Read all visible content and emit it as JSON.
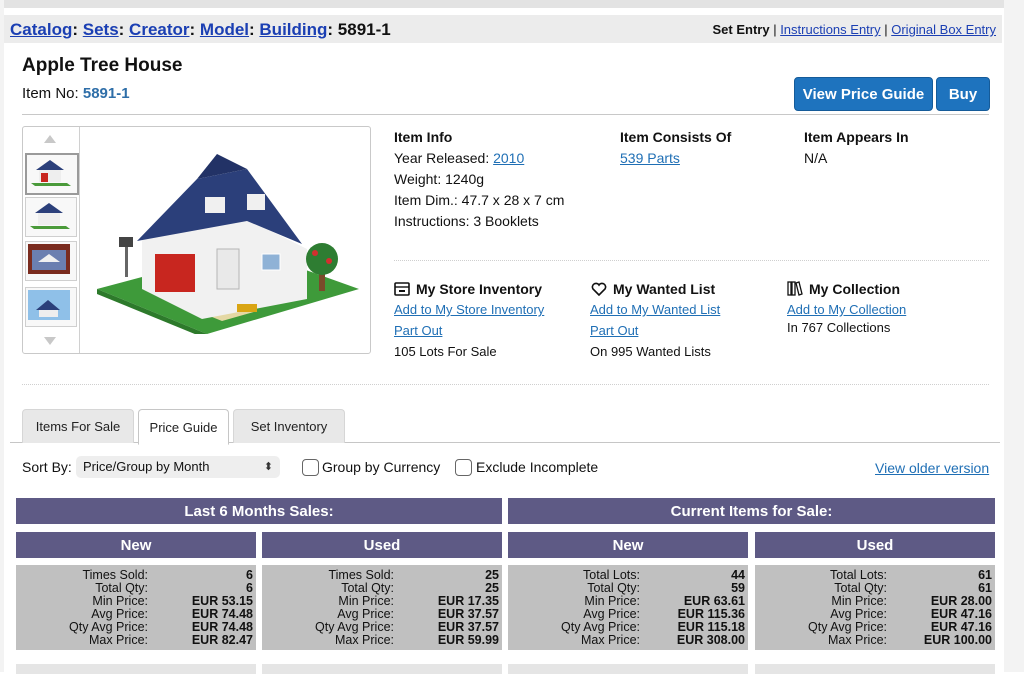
{
  "breadcrumb": [
    {
      "label": "Catalog"
    },
    {
      "label": "Sets"
    },
    {
      "label": "Creator"
    },
    {
      "label": "Model"
    },
    {
      "label": "Building"
    }
  ],
  "breadcrumb_current": "5891-1",
  "entry_links": {
    "set_entry": "Set Entry",
    "instructions_entry": "Instructions Entry",
    "box_entry": "Original Box Entry"
  },
  "item": {
    "title": "Apple Tree House",
    "item_no_label": "Item No:",
    "item_no": "5891-1"
  },
  "buttons": {
    "price_guide": "View Price Guide",
    "buy": "Buy"
  },
  "info": {
    "item_info_heading": "Item Info",
    "year_label": "Year Released:",
    "year": "2010",
    "weight": "Weight: 1240g",
    "dim": "Item Dim.: 47.7 x 28 x 7 cm",
    "instructions": "Instructions: 3 Booklets",
    "consists_heading": "Item Consists Of",
    "parts": "539 Parts",
    "appears_heading": "Item Appears In",
    "appears": "N/A"
  },
  "store": {
    "heading": "My Store Inventory",
    "add": "Add to My Store Inventory",
    "part_out": "Part Out",
    "count": "105 Lots For Sale"
  },
  "wanted": {
    "heading": "My Wanted List",
    "add": "Add to My Wanted List",
    "part_out": "Part Out",
    "count": "On 995 Wanted Lists"
  },
  "collection": {
    "heading": "My Collection",
    "add": "Add to My Collection",
    "count": "In 767 Collections"
  },
  "tabs": [
    {
      "label": "Items For Sale",
      "active": false
    },
    {
      "label": "Price Guide",
      "active": true
    },
    {
      "label": "Set Inventory",
      "active": false
    }
  ],
  "sort": {
    "label": "Sort By:",
    "value": "Price/Group by Month"
  },
  "checkboxes": {
    "group_currency": "Group by Currency",
    "exclude_incomplete": "Exclude Incomplete"
  },
  "older_version": "View older version",
  "price_guide": {
    "sales_heading": "Last 6 Months Sales:",
    "current_heading": "Current Items for Sale:",
    "new_label": "New",
    "used_label": "Used",
    "sales_new": [
      [
        "Times Sold:",
        "6"
      ],
      [
        "Total Qty:",
        "6"
      ],
      [
        "Min Price:",
        "EUR 53.15"
      ],
      [
        "Avg Price:",
        "EUR 74.48"
      ],
      [
        "Qty Avg Price:",
        "EUR 74.48"
      ],
      [
        "Max Price:",
        "EUR 82.47"
      ]
    ],
    "sales_used": [
      [
        "Times Sold:",
        "25"
      ],
      [
        "Total Qty:",
        "25"
      ],
      [
        "Min Price:",
        "EUR 17.35"
      ],
      [
        "Avg Price:",
        "EUR 37.57"
      ],
      [
        "Qty Avg Price:",
        "EUR 37.57"
      ],
      [
        "Max Price:",
        "EUR 59.99"
      ]
    ],
    "current_new": [
      [
        "Total Lots:",
        "44"
      ],
      [
        "Total Qty:",
        "59"
      ],
      [
        "Min Price:",
        "EUR 63.61"
      ],
      [
        "Avg Price:",
        "EUR 115.36"
      ],
      [
        "Qty Avg Price:",
        "EUR 115.18"
      ],
      [
        "Max Price:",
        "EUR 308.00"
      ]
    ],
    "current_used": [
      [
        "Total Lots:",
        "61"
      ],
      [
        "Total Qty:",
        "61"
      ],
      [
        "Min Price:",
        "EUR 28.00"
      ],
      [
        "Avg Price:",
        "EUR 47.16"
      ],
      [
        "Qty Avg Price:",
        "EUR 47.16"
      ],
      [
        "Max Price:",
        "EUR 100.00"
      ]
    ]
  },
  "colors": {
    "header_purple": "#5e5a85",
    "link_blue": "#1f6fb5",
    "button_blue": "#1e73be",
    "box_gray": "#c0c0c0"
  }
}
